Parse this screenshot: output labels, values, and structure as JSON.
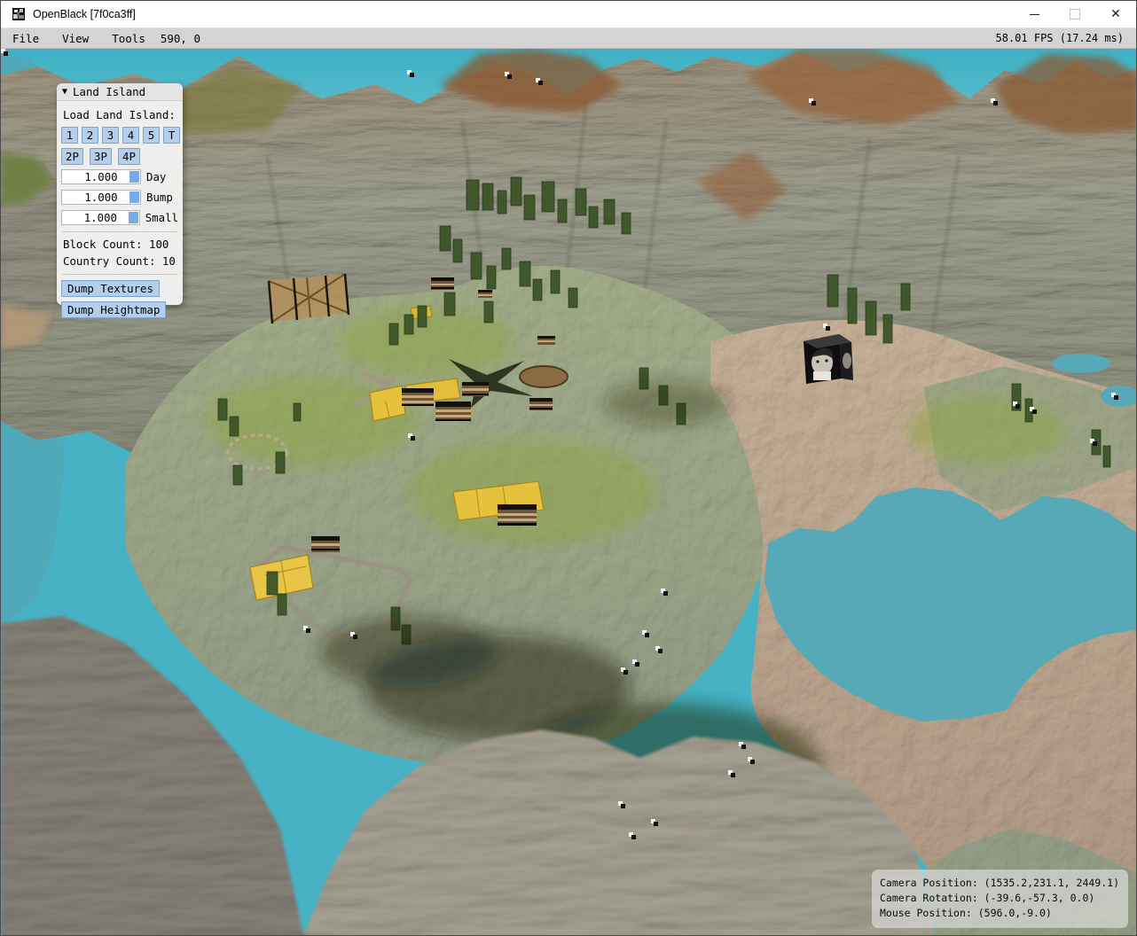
{
  "window": {
    "title": "OpenBlack [7f0ca3ff]",
    "controls": {
      "minimize": "minimize",
      "maximize": "maximize",
      "close_glyph": "✕"
    }
  },
  "menu_bar": {
    "items": [
      {
        "label": "File"
      },
      {
        "label": "View"
      },
      {
        "label": "Tools"
      }
    ],
    "coords_label": "590, 0",
    "fps_label": "58.01 FPS (17.24 ms)"
  },
  "land_island_panel": {
    "collapse_icon": "▼",
    "title": "Land Island",
    "load_label": "Load Land Island:",
    "island_buttons": [
      "1",
      "2",
      "3",
      "4",
      "5",
      "T"
    ],
    "player_buttons": [
      "2P",
      "3P",
      "4P"
    ],
    "sliders": [
      {
        "value": "1.000",
        "label": "Day"
      },
      {
        "value": "1.000",
        "label": "Bump"
      },
      {
        "value": "1.000",
        "label": "Small"
      }
    ],
    "block_count": {
      "label": "Block Count:",
      "value": "100"
    },
    "country_count": {
      "label": "Country Count:",
      "value": "10"
    },
    "dump_textures_label": "Dump Textures",
    "dump_heightmap_label": "Dump Heightmap"
  },
  "debug_overlay": {
    "camera_position": "Camera Position: (1535.2,231.1, 2449.1)",
    "camera_rotation": "Camera Rotation: (-39.6,-57.3, 0.0)",
    "mouse_position": "Mouse Position: (596.0,-9.0)"
  },
  "colors": {
    "accent_button": "#b3cfec",
    "accent_button_border": "#7fa3c8",
    "drag_handle": "#75abe8",
    "water": "#4fa9b8",
    "sky": "#46b2c4",
    "grass": "#6e8040",
    "sand": "#b3987a",
    "wheat": "#e6c23c"
  }
}
